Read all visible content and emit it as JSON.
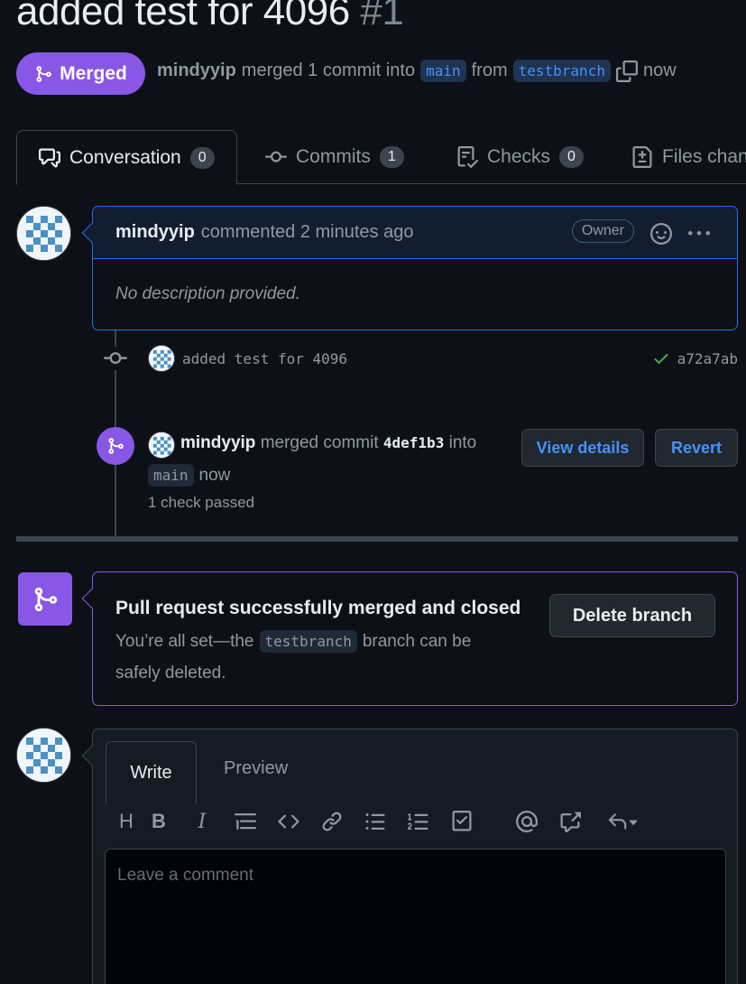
{
  "pr": {
    "title": "added test for 4096",
    "number": "#1",
    "status": "Merged",
    "author": "mindyyip",
    "merge_text": "merged 1 commit into",
    "base_branch": "main",
    "from_text": "from",
    "head_branch": "testbranch",
    "time": "now"
  },
  "tabs": [
    {
      "label": "Conversation",
      "count": "0"
    },
    {
      "label": "Commits",
      "count": "1"
    },
    {
      "label": "Checks",
      "count": "0"
    },
    {
      "label": "Files chan"
    }
  ],
  "comment": {
    "author": "mindyyip",
    "action": "commented 2 minutes ago",
    "badge": "Owner",
    "body": "No description provided."
  },
  "commit": {
    "message": "added test for 4096",
    "sha": "a72a7ab"
  },
  "merge_event": {
    "author": "mindyyip",
    "text": "merged commit",
    "sha": "4def1b3",
    "into": "into",
    "branch": "main",
    "time": "now",
    "checks": "1 check passed",
    "view_details": "View details",
    "revert": "Revert"
  },
  "merged_box": {
    "title": "Pull request successfully merged and closed",
    "text_before": "You’re all set—the",
    "branch": "testbranch",
    "text_after": "branch can be",
    "text_line2": "safely deleted.",
    "delete_button": "Delete branch"
  },
  "editor": {
    "write_tab": "Write",
    "preview_tab": "Preview",
    "placeholder": "Leave a comment"
  },
  "colors": {
    "merged_purple": "#8957e5",
    "link_blue": "#4493f8",
    "success_green": "#3fb950",
    "background": "#0d1117"
  }
}
